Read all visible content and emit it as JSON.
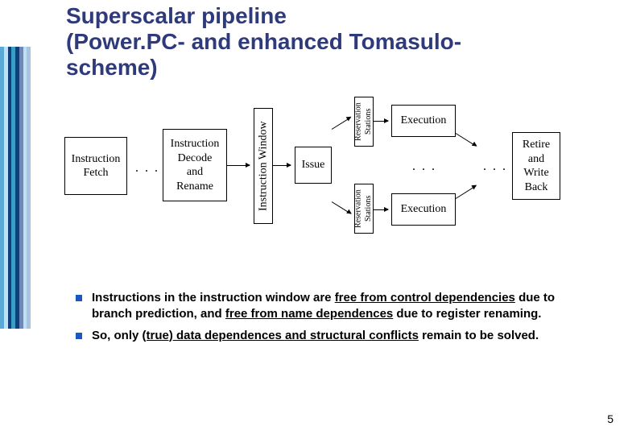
{
  "title_line1": "Superscalar pipeline",
  "title_line2": "(Power.PC- and enhanced Tomasulo-",
  "title_line3": "scheme)",
  "sidebar_colors": [
    "#5aa9d6",
    "#c0dff0",
    "#0f3f7a",
    "#3b9cc6",
    "#0f3f7a",
    "#6e88b8",
    "#c0dff0",
    "#a8c4e0"
  ],
  "diagram": {
    "fetch": "Instruction\nFetch",
    "decode": "Instruction\nDecode\nand\nRename",
    "window": "Instruction Window",
    "issue": "Issue",
    "rs": "Reservation\nStations",
    "exec": "Execution",
    "retire": "Retire\nand\nWrite\nBack",
    "ellipsis": ". . ."
  },
  "bullets": [
    {
      "pre": "Instructions in the instruction window are ",
      "u1": "free from control dependencies",
      "mid": " due to branch prediction, and ",
      "u2": "free from name dependences",
      "post": " due to register renaming."
    },
    {
      "pre": "So, only ",
      "u1": "(true) data dependences and structural conflicts",
      "mid": "",
      "u2": "",
      "post": " remain to be solved."
    }
  ],
  "page_number": "5"
}
